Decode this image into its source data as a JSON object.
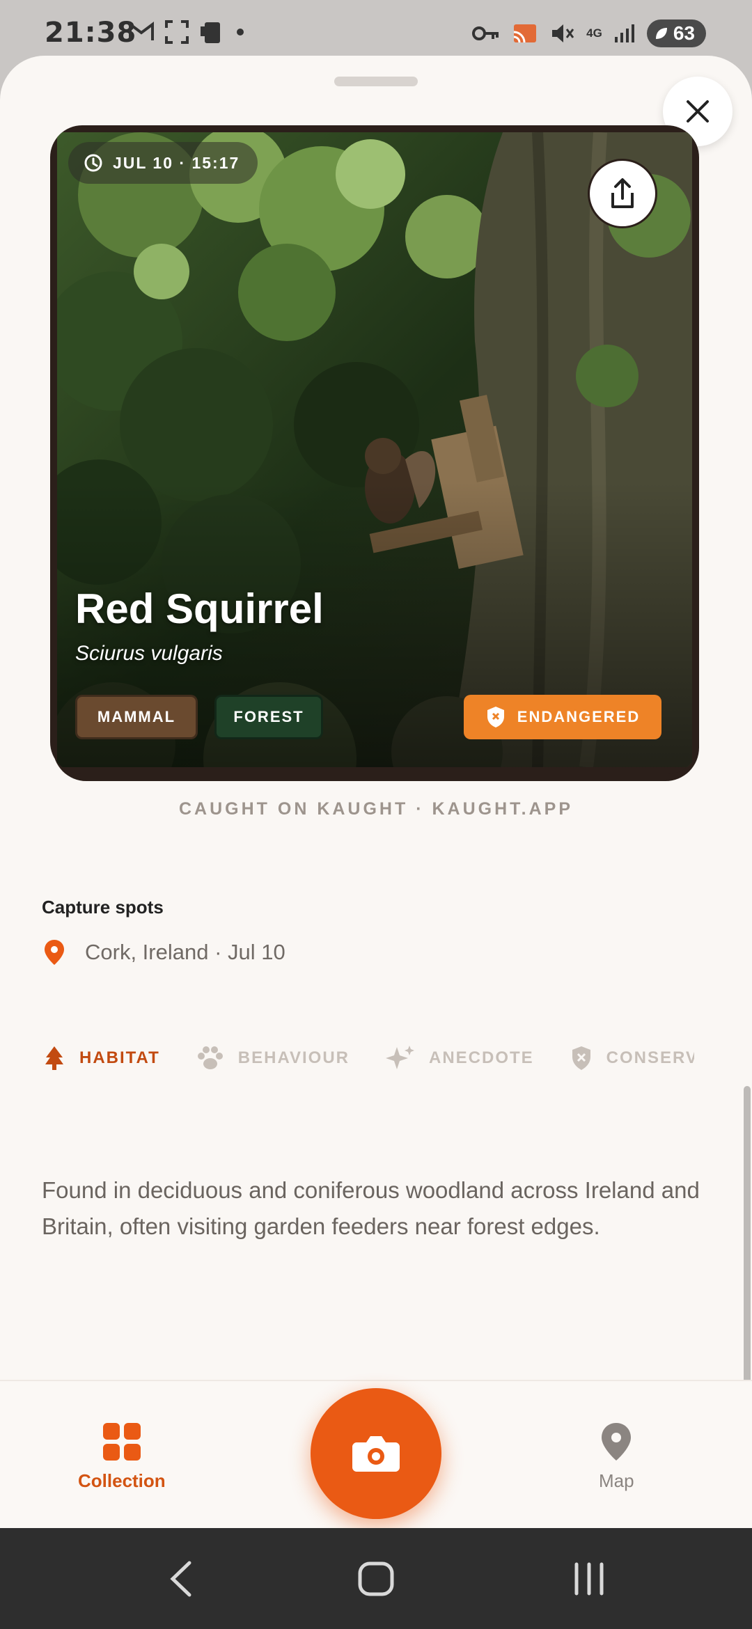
{
  "status_bar": {
    "time": "21:38",
    "battery": "63",
    "network": "4G"
  },
  "card": {
    "timestamp": "JUL 10 · 15:17",
    "species_name": "Red Squirrel",
    "latin_name": "Sciurus vulgaris",
    "tags": {
      "class": "MAMMAL",
      "habitat": "FOREST",
      "status": "ENDANGERED"
    }
  },
  "caught_line": "CAUGHT ON KAUGHT · KAUGHT.APP",
  "capture": {
    "title": "Capture spots",
    "location": "Cork, Ireland · Jul 10"
  },
  "tabs": [
    {
      "label": "HABITAT",
      "icon": "tree-icon",
      "active": true
    },
    {
      "label": "BEHAVIOUR",
      "icon": "paw-icon",
      "active": false
    },
    {
      "label": "ANECDOTE",
      "icon": "sparkle-icon",
      "active": false
    },
    {
      "label": "CONSERV",
      "icon": "shield-icon",
      "active": false
    }
  ],
  "habitat_text": "Found in deciduous and coniferous woodland across Ireland and Britain, often visiting garden feeders near forest edges.",
  "bottom_nav": {
    "collection_label": "Collection",
    "map_label": "Map"
  },
  "colors": {
    "accent": "#ea5a14",
    "endangered": "#ee8327",
    "mammal_tag": "#6a4a2f",
    "forest_tag": "#1f4128"
  }
}
